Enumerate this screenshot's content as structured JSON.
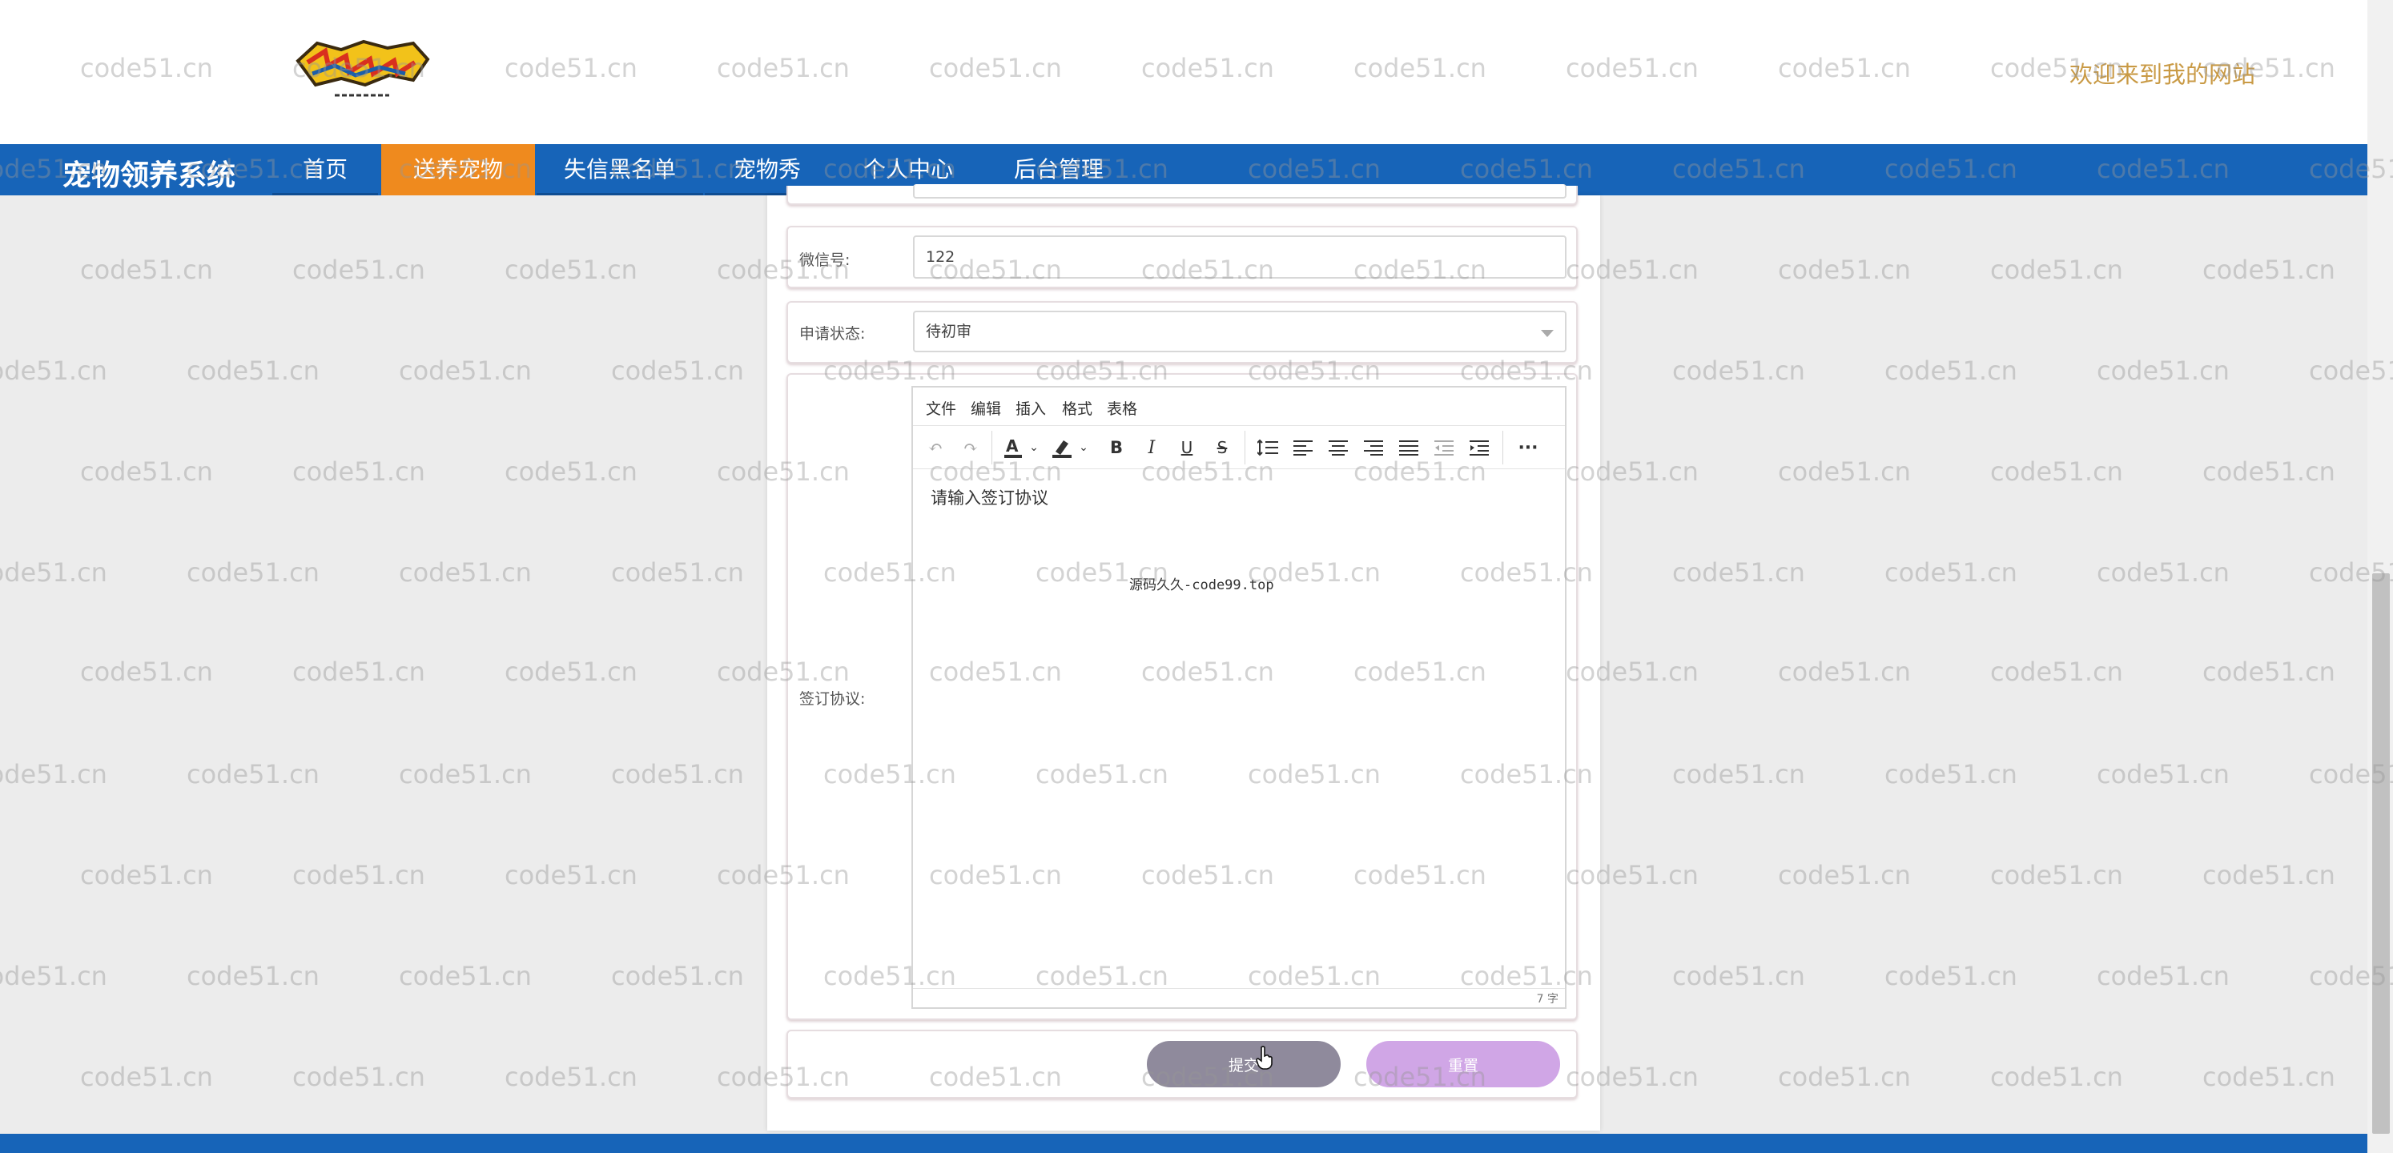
{
  "header": {
    "welcome_text": "欢迎来到我的网站"
  },
  "nav": {
    "brand": "宠物领养系统",
    "items": [
      {
        "label": "首页",
        "active": false
      },
      {
        "label": "送养宠物",
        "active": true
      },
      {
        "label": "失信黑名单",
        "active": false
      },
      {
        "label": "宠物秀",
        "active": false
      },
      {
        "label": "个人中心",
        "active": false
      },
      {
        "label": "后台管理",
        "active": false
      }
    ]
  },
  "form": {
    "wechat": {
      "label": "微信号:",
      "value": "122"
    },
    "status": {
      "label": "申请状态:",
      "value": "待初审"
    },
    "agreement": {
      "label": "签订协议:",
      "menu": [
        "文件",
        "编辑",
        "插入",
        "格式",
        "表格"
      ],
      "content": "请输入签订协议",
      "embedded_mark": "源码久久-code99.top",
      "word_count": "7 字"
    },
    "submit_label": "提交",
    "reset_label": "重置"
  },
  "watermark_text": "code51.cn",
  "colors": {
    "nav_bg": "#1764b8",
    "nav_active": "#ef8a1e",
    "welcome": "#c99a45",
    "submit_btn": "#8f8a9c",
    "reset_btn": "#d0a6e6",
    "page_bg": "#ececec"
  }
}
